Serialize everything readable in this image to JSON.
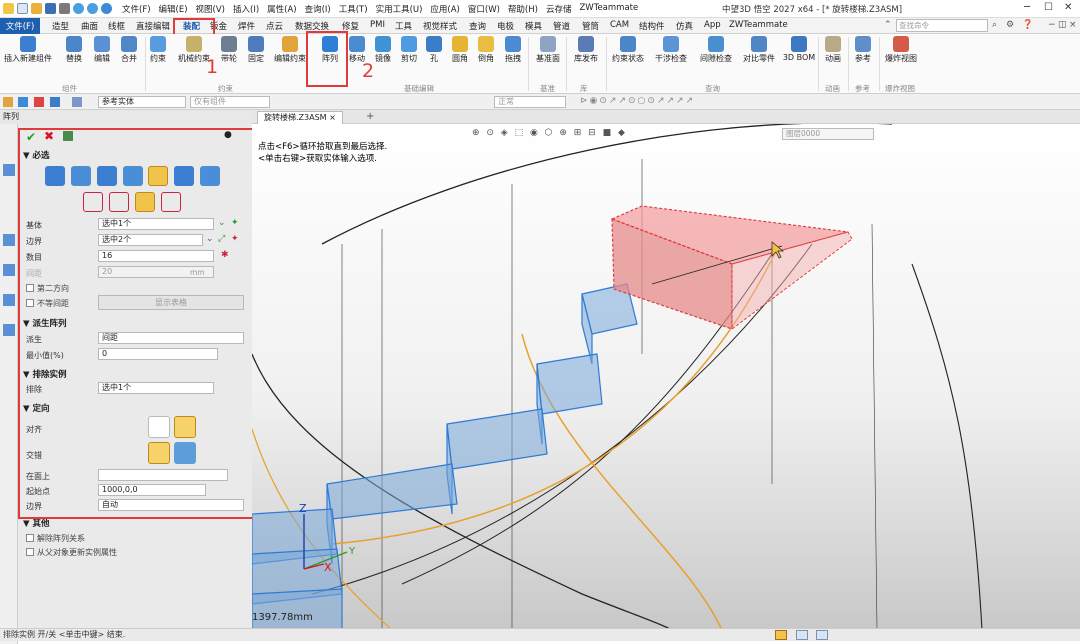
{
  "app": {
    "title": "中望3D 悟空 2027 x64 - [* 旋转楼梯.Z3ASM]"
  },
  "menubar": [
    "文件(F)",
    "编辑(E)",
    "视图(V)",
    "插入(I)",
    "属性(A)",
    "查询(I)",
    "工具(T)",
    "实用工具(U)",
    "应用(A)",
    "窗口(W)",
    "帮助(H)",
    "云存储",
    "ZWTeammate"
  ],
  "ribbon_tabs": [
    "文件(F)",
    "造型",
    "曲面",
    "线框",
    "直接编辑",
    "装配",
    "钣金",
    "焊件",
    "点云",
    "数据交换",
    "修复",
    "PMI",
    "工具",
    "视觉样式",
    "查询",
    "电极",
    "模具",
    "管道",
    "管筒",
    "CAM",
    "结构件",
    "仿真",
    "App",
    "ZWTeammate"
  ],
  "search_placeholder": "查找命令",
  "ribbon": {
    "buttons": [
      "插入新建组件",
      "替换",
      "编辑",
      "合并",
      "约束",
      "机械约束",
      "带轮",
      "固定",
      "编辑约束",
      "阵列",
      "移动",
      "镜像",
      "剪切",
      "孔",
      "圆角",
      "倒角",
      "拖拽",
      "基准面",
      "库发布",
      "约束状态",
      "干涉检查",
      "间隙检查",
      "对比零件",
      "3D BOM",
      "动画",
      "参考",
      "爆炸视图"
    ],
    "groups": [
      "组件",
      "约束",
      "基础编辑",
      "基准",
      "库",
      "查询",
      "动画",
      "参考",
      "爆炸视图"
    ]
  },
  "toolbar2": {
    "combo1": "参考实体",
    "combo2": "仅有组件",
    "combo3": "正常"
  },
  "doc_tab": "旋转楼梯.Z3ASM",
  "panel": {
    "title": "阵列",
    "sections": {
      "required": "必选",
      "derived": "派生阵列",
      "exclude": "排除实例",
      "orient": "定向",
      "other": "其他"
    },
    "labels": {
      "base": "基体",
      "boundary": "边界",
      "count": "数目",
      "spacing": "间距",
      "orient_align": "对齐",
      "orient_cross": "交错",
      "on_face": "在面上",
      "start": "起始点",
      "boundary2": "边界",
      "derive": "派生",
      "min_value": "最小值(%)",
      "exclude": "排除"
    },
    "values": {
      "base": "选中1个",
      "boundary": "选中2个",
      "count": "16",
      "spacing": "20",
      "spacing_unit": "mm",
      "derive": "间距",
      "min_value": "0",
      "exclude": "选中1个",
      "start": "1000,0,0",
      "boundary2": "自动"
    },
    "checks": {
      "second_dir": "第二方向",
      "unequal": "不等间距",
      "dissolve": "解除阵列关系",
      "update_attr": "从父对象更新实例属性"
    },
    "buttons": {
      "show_table": "显示表格"
    }
  },
  "viewport": {
    "hint_line1": "点击<F6>循环拾取直到最后选择.",
    "hint_line2": "<单击右键>获取实体输入选项.",
    "layer": "图层0000",
    "scale": "1397.78mm",
    "axes": {
      "z": "Z",
      "y": "Y",
      "x": "X"
    }
  },
  "annotations": [
    "1",
    "2",
    "3"
  ],
  "status": "排除实例 开/关 <单击中键> 结束."
}
